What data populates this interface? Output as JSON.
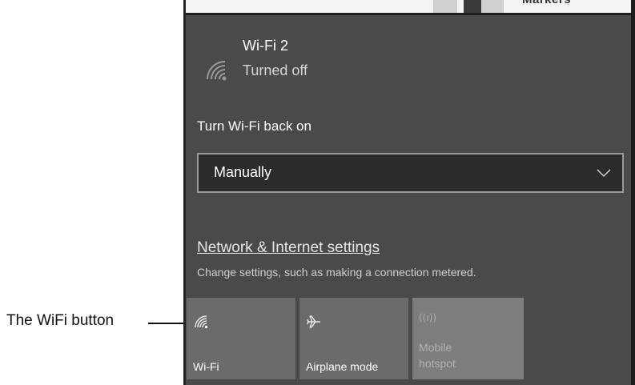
{
  "annotation": {
    "label": "The WiFi button"
  },
  "background_strip": {
    "text": "Markers"
  },
  "network": {
    "name": "Wi-Fi 2",
    "status": "Turned off",
    "icon": "wifi-signal-icon"
  },
  "turn_on": {
    "label": "Turn Wi-Fi back on",
    "selected": "Manually",
    "icon": "chevron-down-icon"
  },
  "settings": {
    "link": "Network & Internet settings",
    "description": "Change settings, such as making a connection metered."
  },
  "quick_actions": [
    {
      "label": "Wi-Fi",
      "icon": "wifi-icon"
    },
    {
      "label": "Airplane mode",
      "icon": "airplane-icon"
    },
    {
      "label_line1": "Mobile",
      "label_line2": "hotspot",
      "icon": "hotspot-icon"
    }
  ],
  "colors": {
    "panel_bg": "#4a4a4a",
    "tile_bg": "#6b6b6b",
    "dropdown_bg": "#2b2b2b"
  }
}
